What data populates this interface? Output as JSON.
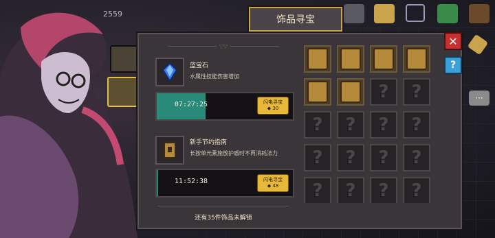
{
  "header": {
    "score": "2559",
    "title": "饰品寻宝"
  },
  "icons": {
    "close": "close-icon",
    "help": "help-icon",
    "chat": "chat-icon",
    "cart": "shop-cart-icon",
    "gem": "blue-gem-icon"
  },
  "items": [
    {
      "name": "蓝宝石",
      "desc": "水属性技能伤害增加",
      "timer": "07:27:25",
      "progress": 0.36,
      "button": "闪电寻宝",
      "cost": "30"
    },
    {
      "name": "新手节约指南",
      "desc": "长按单元素施放护盾时不再消耗法力",
      "timer": "11:52:38",
      "progress": 0.0,
      "button": "闪电寻宝",
      "cost": "48"
    }
  ],
  "footer": "还有35件饰品未解锁",
  "grid": {
    "unlocked_count": 6,
    "cells_visible": 20
  }
}
